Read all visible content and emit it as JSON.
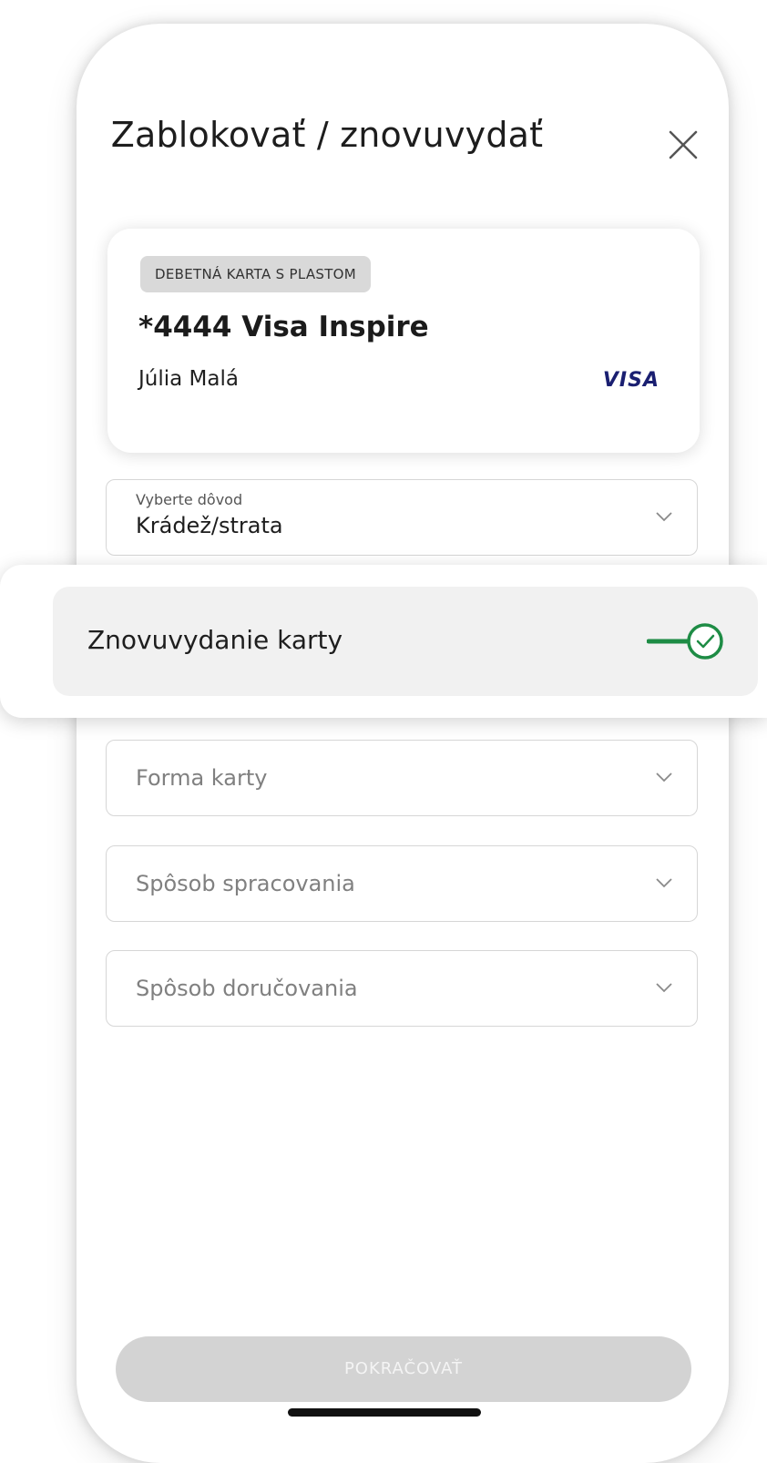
{
  "header": {
    "title": "Zablokovať / znovuvydať"
  },
  "card": {
    "type_badge": "DEBETNÁ KARTA S PLASTOM",
    "name": "*4444 Visa Inspire",
    "holder": "Júlia Malá",
    "brand": "VISA"
  },
  "reason_select": {
    "label": "Vyberte dôvod",
    "value": "Krádež/strata"
  },
  "reissue_toggle": {
    "label": "Znovuvydanie karty",
    "checked": true,
    "accent": "#1e8c45"
  },
  "form_select": {
    "placeholder": "Forma karty"
  },
  "processing_select": {
    "placeholder": "Spôsob spracovania"
  },
  "delivery_select": {
    "placeholder": "Spôsob doručovania"
  },
  "actions": {
    "continue_label": "POKRAČOVAŤ",
    "continue_disabled": true
  }
}
